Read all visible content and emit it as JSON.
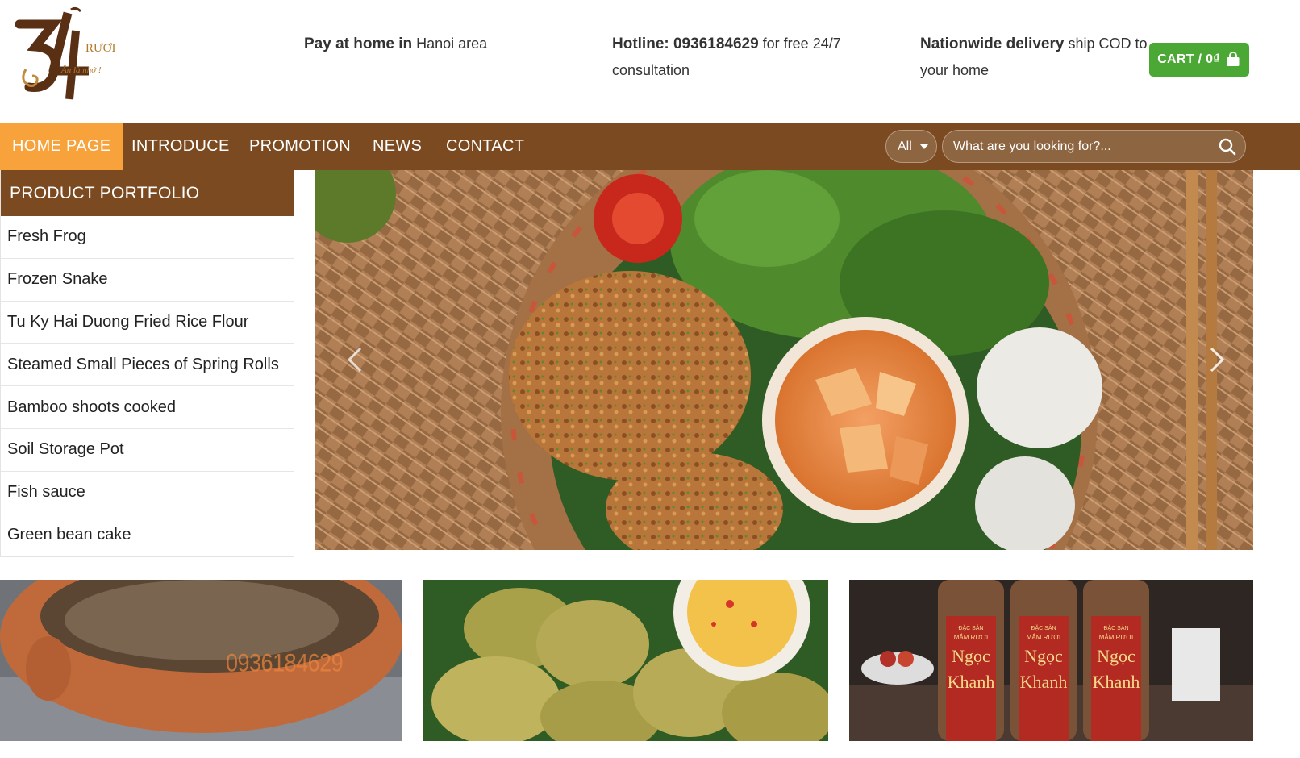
{
  "header": {
    "logo": {
      "number": "34",
      "brand": "RƯƠI",
      "slogan": "Ăn là nhớ !"
    },
    "pay": {
      "bold": "Pay at home in",
      "text": " Hanoi area"
    },
    "hotline": {
      "bold": "Hotline: 0936184629",
      "text": " for free 24/7 consultation"
    },
    "delivery": {
      "bold": "Nationwide delivery",
      "text": " ship COD to your home"
    },
    "cart_label": "CART / 0₫"
  },
  "nav": {
    "items": [
      {
        "label": "HOME PAGE",
        "active": true
      },
      {
        "label": "INTRODUCE",
        "active": false
      },
      {
        "label": "PROMOTION",
        "active": false
      },
      {
        "label": "NEWS",
        "active": false
      },
      {
        "label": "CONTACT",
        "active": false
      }
    ],
    "search": {
      "category": "All",
      "placeholder": "What are you looking for?..."
    }
  },
  "sidebar": {
    "title": "PRODUCT PORTFOLIO",
    "items": [
      {
        "label": "Fresh Frog"
      },
      {
        "label": "Frozen Snake"
      },
      {
        "label": "Tu Ky Hai Duong Fried Rice Flour"
      },
      {
        "label": "Steamed Small Pieces of Spring Rolls"
      },
      {
        "label": "Bamboo shoots cooked"
      },
      {
        "label": "Soil Storage Pot"
      },
      {
        "label": "Fish sauce"
      },
      {
        "label": "Green bean cake"
      }
    ]
  },
  "banners": {
    "watermark": "0936184629",
    "bottle_label": {
      "top": "ĐẶC SẢN",
      "middle": "MẮM RƯƠI",
      "name1": "Ngọc",
      "name2": "Khanh"
    }
  },
  "colors": {
    "brown": "#7b4a20",
    "orange": "#f7a23a",
    "green": "#4ca834"
  },
  "icons": {
    "cart": "shopping-bag-icon",
    "search": "search-icon",
    "dropdown": "chevron-down-icon",
    "prev": "chevron-left-icon",
    "next": "chevron-right-icon"
  }
}
